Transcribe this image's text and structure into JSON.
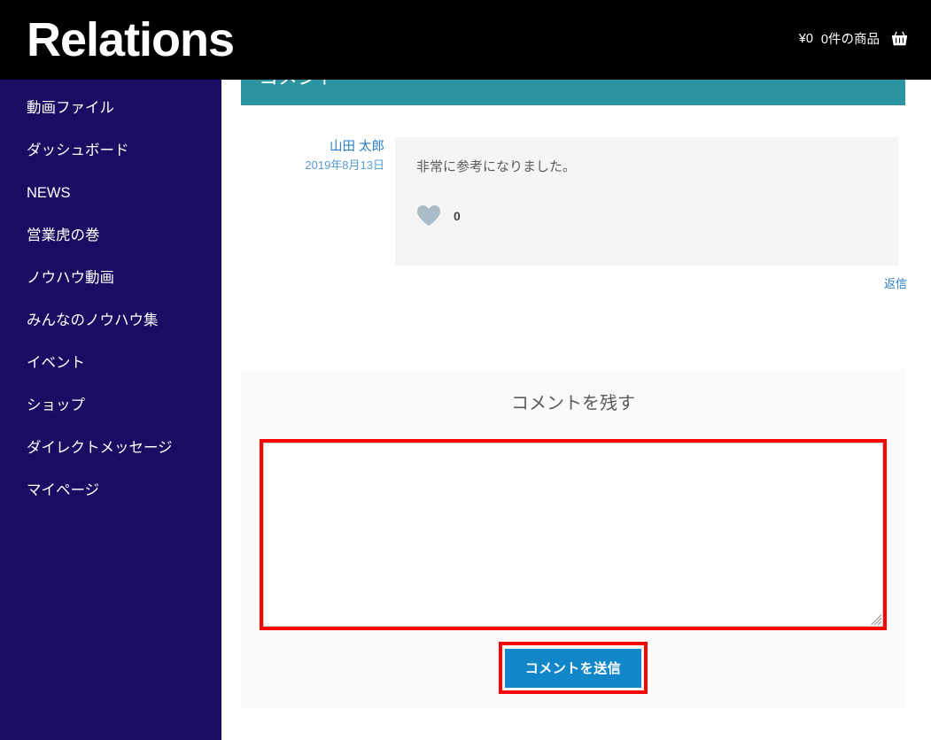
{
  "header": {
    "brand": "Relations",
    "cart": {
      "price": "¥0",
      "item_count_label": "0件の商品",
      "icon": "shopping-basket-icon"
    },
    "background_color": "#000000"
  },
  "sidebar": {
    "background_color": "#190d63",
    "items": [
      {
        "label": "動画ファイル"
      },
      {
        "label": "ダッシュボード"
      },
      {
        "label": "NEWS"
      },
      {
        "label": "営業虎の巻"
      },
      {
        "label": "ノウハウ動画"
      },
      {
        "label": "みんなのノウハウ集"
      },
      {
        "label": "イベント"
      },
      {
        "label": "ショップ"
      },
      {
        "label": "ダイレクトメッセージ"
      },
      {
        "label": "マイページ"
      }
    ]
  },
  "main": {
    "section": {
      "title": "コメント",
      "accent_color": "#2c93a1"
    },
    "comment": {
      "author": "山田 太郎",
      "date": "2019年8月13日",
      "text": "非常に参考になりました。",
      "like_icon": "heart-icon",
      "like_count": "0",
      "reply_label": "返信",
      "link_color": "#2a7fc9",
      "body_background": "#f5f5f5"
    },
    "form": {
      "title": "コメントを残す",
      "textarea_value": "",
      "textarea_placeholder": "",
      "submit_label": "コメントを送信",
      "submit_color": "#1187c9",
      "highlight_color": "#fe0000",
      "panel_background": "#fafafa"
    }
  }
}
